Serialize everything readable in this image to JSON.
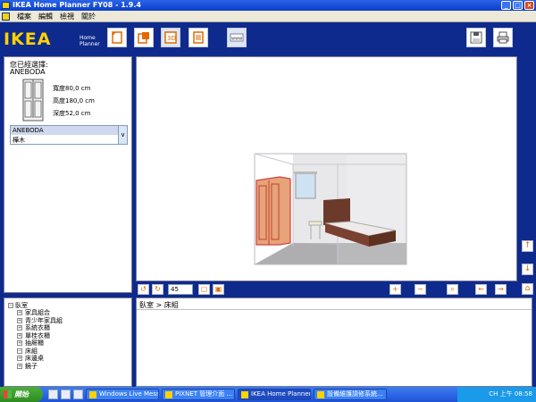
{
  "window": {
    "title": "IKEA Home Planner FY08 - 1.9.4"
  },
  "menu": [
    "檔案",
    "編輯",
    "檢視",
    "關於"
  ],
  "logo": {
    "text": "IKEA",
    "sub1": "Home",
    "sub2": "Planner"
  },
  "toolbar_icons": [
    "new-file-icon",
    "open-file-icon",
    "3d-view-icon",
    "list-icon",
    "www-icon",
    "save-icon",
    "print-icon"
  ],
  "selection": {
    "heading": "您已經選擇:",
    "name": "ANEBODA",
    "width": "寬度80,0 cm",
    "height": "高度180,0 cm",
    "depth": "深度52,0 cm",
    "combo_selected": "ANEBODA",
    "combo_option": "樺木"
  },
  "view_controls": {
    "zoom": "45"
  },
  "tree": {
    "root": "臥室",
    "items": [
      "家具組合",
      "青少年家具組",
      "系統衣櫃",
      "單桂衣櫃",
      "抽屜櫃",
      "床組",
      "床邊桌",
      "鏡子"
    ]
  },
  "catalog": {
    "breadcrumb": "臥室 > 床組"
  },
  "taskbar": {
    "start": "開始",
    "tasks": [
      "Windows Live Mess...",
      "PIXNET 管理介面 ...",
      "IKEA Home Planner...",
      "設備維護請修系統..."
    ],
    "tray_lang": "CH",
    "clock": "上午 08:58"
  },
  "colors": {
    "panel_bg": "#0e2a8c",
    "logo_yellow": "#ffd200",
    "accent_orange": "#e06a00"
  }
}
